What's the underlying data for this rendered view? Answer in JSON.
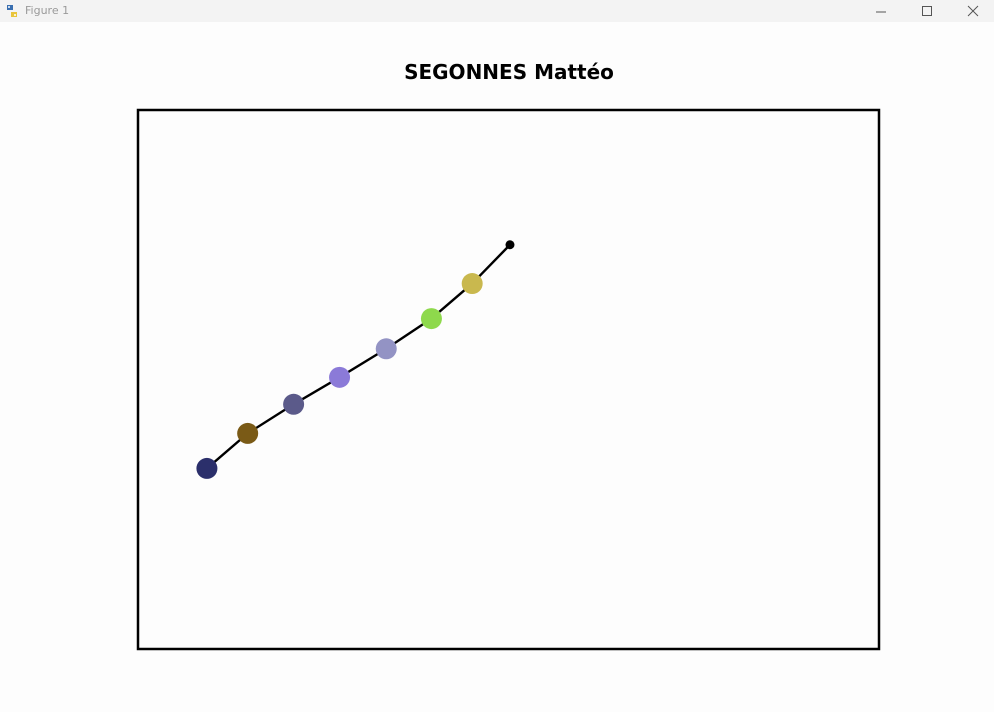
{
  "window": {
    "title": "Figure 1",
    "icons": [
      "python-logo-icon",
      "minimize-icon",
      "maximize-icon",
      "close-icon"
    ]
  },
  "figure": {
    "title": "SEGONNES Mattéo"
  },
  "chart_data": {
    "type": "scatter",
    "title": "SEGONNES Mattéo",
    "xlabel": "",
    "ylabel": "",
    "xlim": [
      0,
      10
    ],
    "ylim": [
      0,
      10
    ],
    "grid": false,
    "axes_visible": false,
    "line_color": "#000000",
    "points": [
      {
        "x": 0.93,
        "y": 3.35,
        "color": "#2b2f6b"
      },
      {
        "x": 1.48,
        "y": 4.0,
        "color": "#7a5a16"
      },
      {
        "x": 2.1,
        "y": 4.54,
        "color": "#5b5a8a"
      },
      {
        "x": 2.72,
        "y": 5.04,
        "color": "#8b7ad8"
      },
      {
        "x": 3.35,
        "y": 5.57,
        "color": "#9393c4"
      },
      {
        "x": 3.96,
        "y": 6.13,
        "color": "#8ed94c"
      },
      {
        "x": 4.51,
        "y": 6.78,
        "color": "#c9b84e"
      },
      {
        "x": 5.02,
        "y": 7.5,
        "color": "#000000",
        "end": true
      }
    ]
  }
}
